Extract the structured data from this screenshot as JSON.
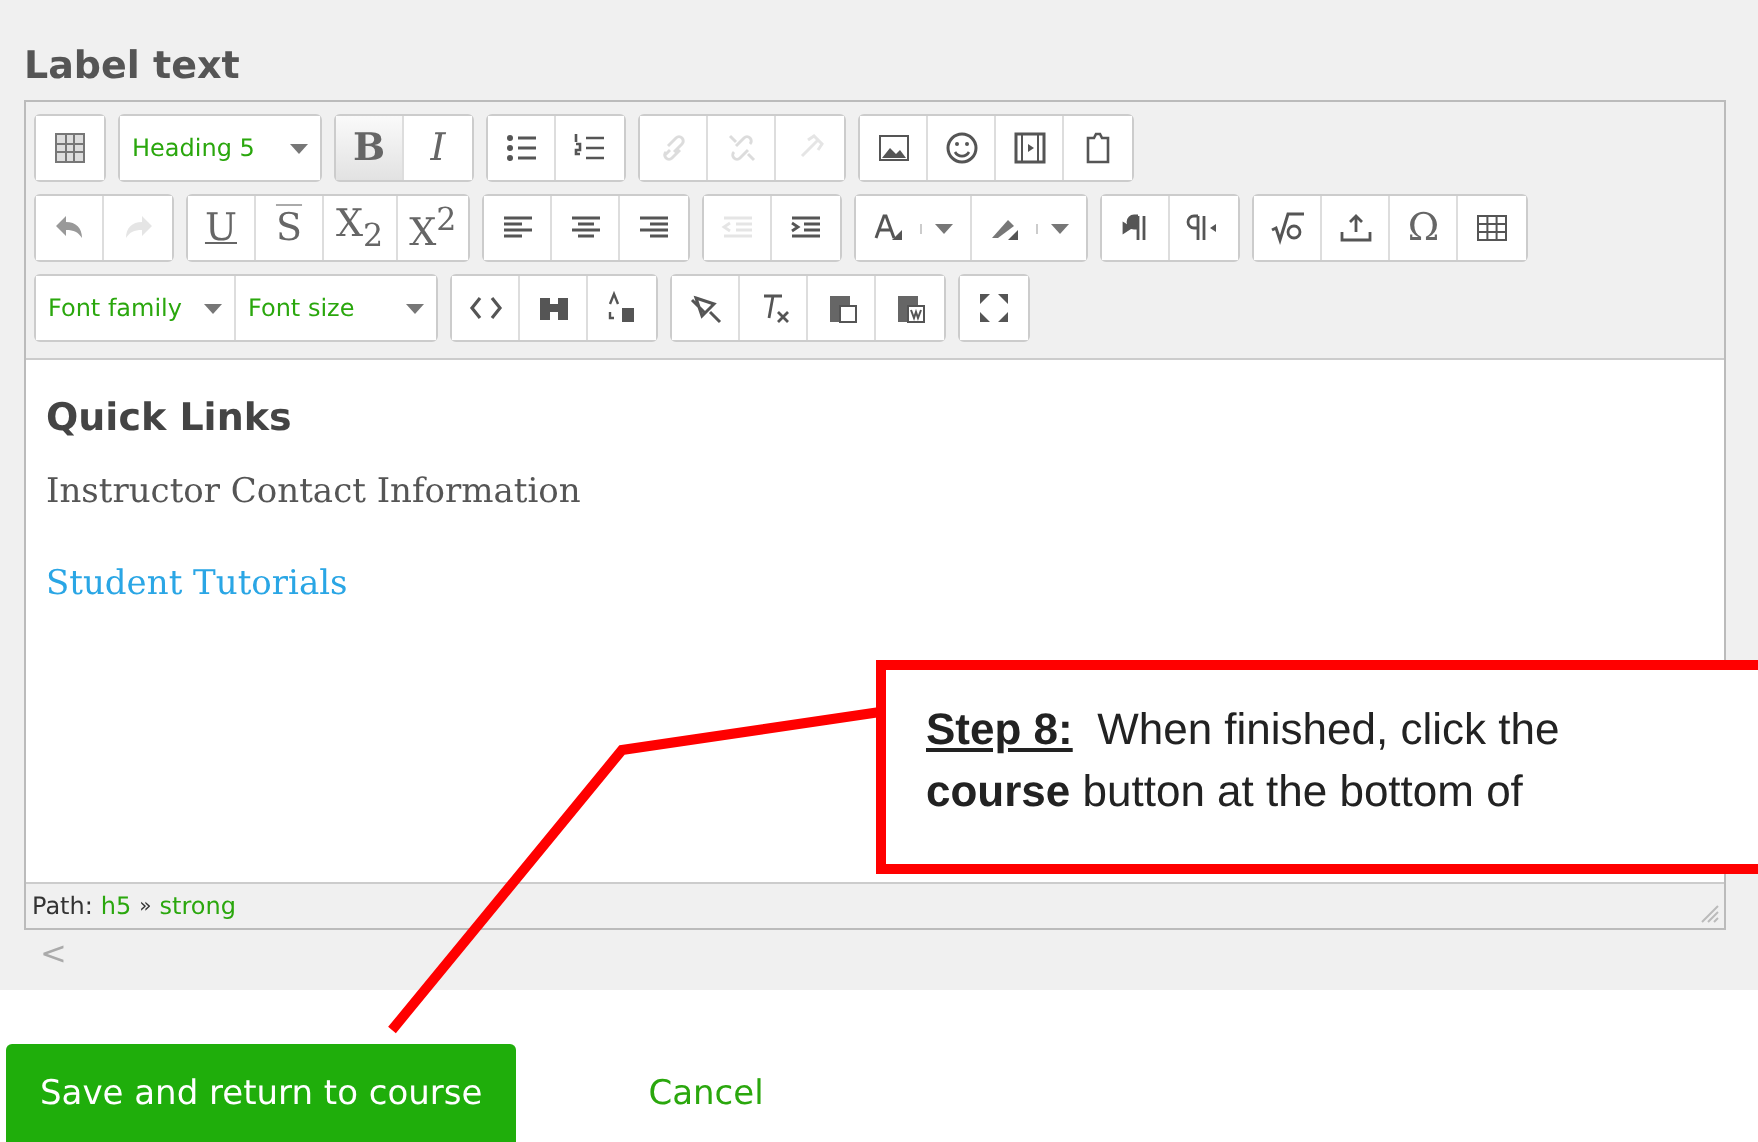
{
  "label": "Label text",
  "toolbar": [
    [
      [
        {
          "kind": "icon",
          "disabled": false
        }
      ],
      [
        {
          "kind": "dropdown",
          "text": "Heading 5"
        }
      ],
      [
        {
          "kind": "glyph",
          "text": "B",
          "active": true
        },
        {
          "kind": "glyph",
          "text": "I",
          "active": false
        }
      ],
      [
        {
          "kind": "icon",
          "disabled": false
        },
        {
          "kind": "icon",
          "disabled": false
        }
      ],
      [
        {
          "kind": "icon",
          "disabled": true
        },
        {
          "kind": "icon",
          "disabled": true
        },
        {
          "kind": "icon",
          "disabled": true
        }
      ],
      [
        {
          "kind": "icon",
          "disabled": false
        },
        {
          "kind": "icon",
          "disabled": false
        },
        {
          "kind": "icon",
          "disabled": false
        },
        {
          "kind": "icon",
          "disabled": false
        }
      ]
    ],
    [
      [
        {
          "kind": "icon",
          "disabled": false
        },
        {
          "kind": "icon",
          "disabled": true
        }
      ],
      [
        {
          "kind": "glyph",
          "text": "U",
          "active": false
        },
        {
          "kind": "glyph",
          "text": "S",
          "active": false
        },
        {
          "kind": "glyph",
          "text": "X$_{2}$",
          "active": false
        },
        {
          "kind": "glyph",
          "text": "X$^{2}$",
          "active": false
        }
      ],
      [
        {
          "kind": "icon",
          "disabled": false
        },
        {
          "kind": "icon",
          "disabled": false
        },
        {
          "kind": "icon",
          "disabled": false
        }
      ],
      [
        {
          "kind": "icon",
          "disabled": true
        },
        {
          "kind": "icon",
          "disabled": false
        }
      ],
      [
        {
          "kind": "split",
          "disabled": false
        },
        {
          "kind": "split",
          "disabled": false
        }
      ],
      [
        {
          "kind": "icon",
          "disabled": false
        },
        {
          "kind": "icon",
          "disabled": false
        }
      ],
      [
        {
          "kind": "icon",
          "disabled": false
        },
        {
          "kind": "icon",
          "disabled": false
        },
        {
          "kind": "glyph",
          "text": "Ω",
          "active": false
        },
        {
          "kind": "icon",
          "disabled": false
        }
      ]
    ],
    [
      [
        {
          "kind": "dropdown",
          "text": "Font family"
        },
        {
          "kind": "dropdown",
          "text": "Font size"
        }
      ],
      [
        {
          "kind": "icon",
          "disabled": false
        },
        {
          "kind": "icon",
          "disabled": false
        },
        {
          "kind": "icon",
          "disabled": false
        }
      ],
      [
        {
          "kind": "icon",
          "disabled": false
        },
        {
          "kind": "icon",
          "disabled": false
        },
        {
          "kind": "icon",
          "disabled": false
        },
        {
          "kind": "icon",
          "disabled": false
        }
      ],
      [
        {
          "kind": "icon",
          "disabled": false
        }
      ]
    ]
  ],
  "content": [
    {
      "kind": "heading",
      "text": "Quick Links"
    },
    {
      "kind": "paragraph",
      "text": "Instructor Contact Information"
    },
    {
      "kind": "link",
      "text": "Student Tutorials"
    }
  ],
  "path": {
    "label": "Path:",
    "items": [
      "h5",
      "strong"
    ],
    "separator": "»"
  },
  "scroll_left": "<",
  "buttons": [
    {
      "kind": "primary",
      "text": "Save and return to course"
    },
    {
      "kind": "link",
      "text": "Cancel"
    }
  ],
  "callout": {
    "step": "Step 8:",
    "line1": "When finished, click the",
    "line2": "**course** button at the bottom of"
  }
}
